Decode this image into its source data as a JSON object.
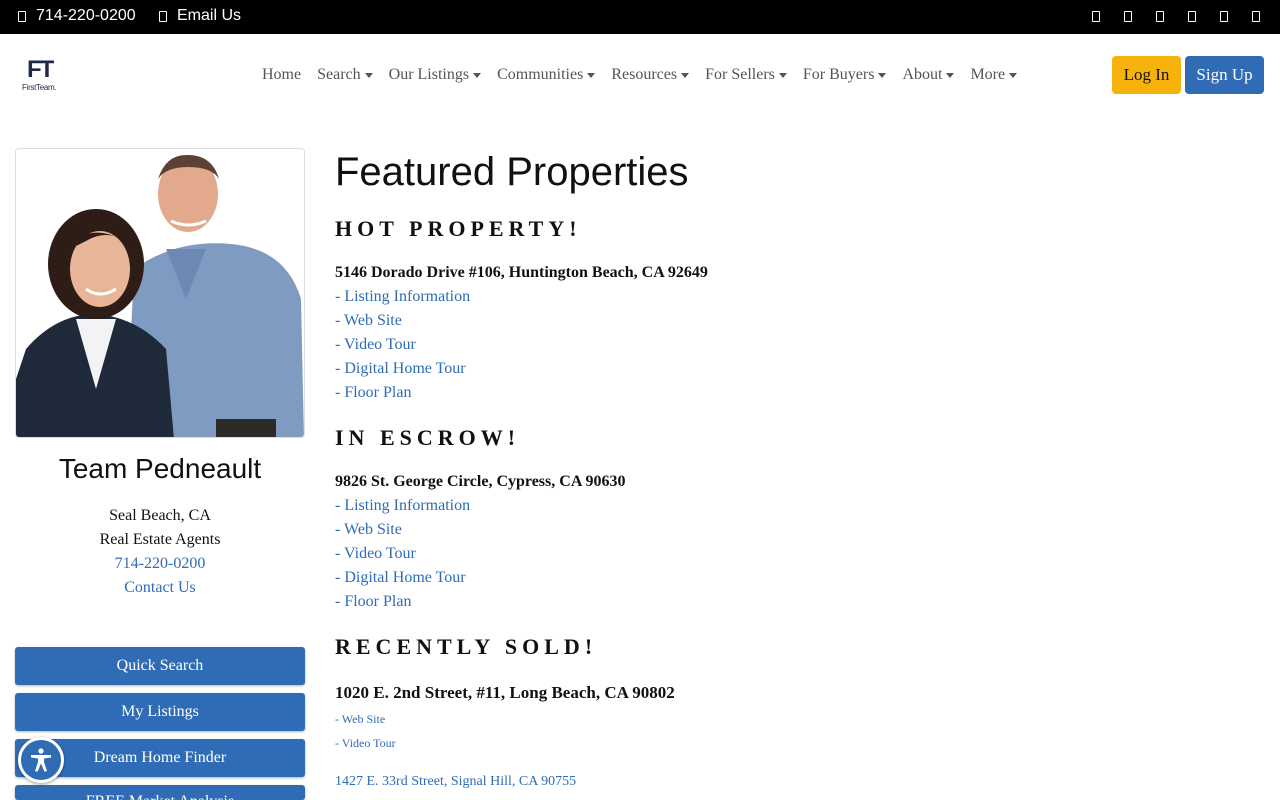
{
  "topbar": {
    "phone": "714-220-0200",
    "email": "Email Us",
    "social_icons": [
      "facebook-icon",
      "twitter-icon",
      "instagram-icon",
      "linkedin-icon",
      "youtube-icon",
      "pinterest-icon"
    ]
  },
  "header": {
    "logo_mark": "FT",
    "logo_word": "FirstTeam.",
    "nav": [
      {
        "label": "Home",
        "dropdown": false
      },
      {
        "label": "Search",
        "dropdown": true
      },
      {
        "label": "Our Listings",
        "dropdown": true
      },
      {
        "label": "Communities",
        "dropdown": true
      },
      {
        "label": "Resources",
        "dropdown": true
      },
      {
        "label": "For Sellers",
        "dropdown": true
      },
      {
        "label": "For Buyers",
        "dropdown": true
      },
      {
        "label": "About",
        "dropdown": true
      },
      {
        "label": "More",
        "dropdown": true
      }
    ],
    "login": "Log In",
    "signup": "Sign Up"
  },
  "sidebar": {
    "name": "Team Pedneault",
    "location": "Seal Beach, CA",
    "role": "Real Estate Agents",
    "phone": "714-220-0200",
    "contact": "Contact Us",
    "buttons": [
      "Quick Search",
      "My Listings",
      "Dream Home Finder",
      "FREE Market Analysis"
    ]
  },
  "main": {
    "title": "Featured Properties",
    "sections": [
      {
        "heading": "HOT PROPERTY!",
        "address": "5146 Dorado Drive #106, Huntington Beach, CA 92649",
        "links": [
          "- Listing Information",
          "- Web Site",
          "- Video Tour",
          "- Digital Home Tour",
          "- Floor Plan"
        ]
      },
      {
        "heading": "IN ESCROW!",
        "address": "9826 St. George Circle, Cypress, CA 90630",
        "links": [
          "- Listing Information",
          "- Web Site",
          "- Video Tour",
          "- Digital Home Tour",
          "- Floor Plan"
        ]
      },
      {
        "heading": "RECENTLY SOLD!",
        "address": "1020 E. 2nd Street, #11, Long Beach, CA 90802",
        "links": [
          "- Web Site",
          "- Video Tour"
        ],
        "next_address": "1427 E. 33rd Street, Signal Hill, CA 90755"
      }
    ]
  },
  "colors": {
    "accent": "#2f6cb5",
    "login": "#f7b20c",
    "topbar": "#000000"
  }
}
